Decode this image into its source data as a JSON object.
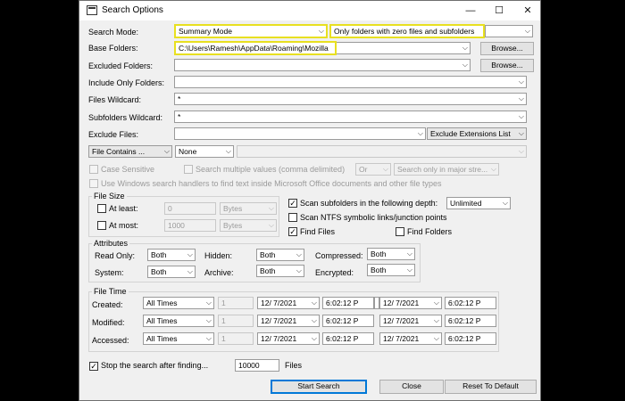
{
  "window": {
    "title": "Search Options",
    "minimize_glyph": "—",
    "maximize_glyph": "☐",
    "close_glyph": "✕"
  },
  "rows": {
    "search_mode_label": "Search Mode:",
    "search_mode_value": "Summary Mode",
    "summary_filter_value": "Only folders with zero files and subfolders",
    "base_folders_label": "Base Folders:",
    "base_folders_value": "C:\\Users\\Ramesh\\AppData\\Roaming\\Mozilla",
    "excluded_folders_label": "Excluded Folders:",
    "excluded_folders_value": "",
    "browse_label": "Browse...",
    "include_only_label": "Include Only Folders:",
    "files_wildcard_label": "Files Wildcard:",
    "files_wildcard_value": "*",
    "subfolders_wildcard_label": "Subfolders Wildcard:",
    "subfolders_wildcard_value": "*",
    "exclude_files_label": "Exclude Files:",
    "exclude_files_value": "",
    "exclude_ext_list": "Exclude Extensions List"
  },
  "contains": {
    "mode": "File Contains ...",
    "type": "None",
    "text": ""
  },
  "options": {
    "case_sensitive": "Case Sensitive",
    "multiple_values": "Search multiple values (comma delimited)",
    "or_value": "Or",
    "major_stream": "Search only in major stre...",
    "windows_handlers": "Use Windows search handlers to find text inside Microsoft Office documents and other file types"
  },
  "file_size": {
    "group_label": "File Size",
    "at_least_label": "At least:",
    "at_least_value": "0",
    "at_most_label": "At most:",
    "at_most_value": "1000",
    "unit": "Bytes"
  },
  "scan": {
    "subfolders_depth": "Scan subfolders in the following depth:",
    "depth_value": "Unlimited",
    "ntfs_links": "Scan NTFS symbolic links/junction points",
    "find_files": "Find Files",
    "find_folders": "Find Folders"
  },
  "attributes": {
    "group_label": "Attributes",
    "read_only_label": "Read Only:",
    "read_only_value": "Both",
    "hidden_label": "Hidden:",
    "hidden_value": "Both",
    "compressed_label": "Compressed:",
    "compressed_value": "Both",
    "system_label": "System:",
    "system_value": "Both",
    "archive_label": "Archive:",
    "archive_value": "Both",
    "encrypted_label": "Encrypted:",
    "encrypted_value": "Both"
  },
  "file_time": {
    "group_label": "File Time",
    "rows": [
      {
        "label": "Created:",
        "mode": "All Times",
        "num": "1",
        "date1": "12/ 7/2021",
        "time1": "6:02:12 P",
        "date2": "12/ 7/2021",
        "time2": "6:02:12 P"
      },
      {
        "label": "Modified:",
        "mode": "All Times",
        "num": "1",
        "date1": "12/ 7/2021",
        "time1": "6:02:12 P",
        "date2": "12/ 7/2021",
        "time2": "6:02:12 P"
      },
      {
        "label": "Accessed:",
        "mode": "All Times",
        "num": "1",
        "date1": "12/ 7/2021",
        "time1": "6:02:12 P",
        "date2": "12/ 7/2021",
        "time2": "6:02:12 P"
      }
    ]
  },
  "stop": {
    "label": "Stop the search after finding...",
    "value": "10000",
    "unit": "Files"
  },
  "buttons": {
    "start": "Start Search",
    "close": "Close",
    "reset": "Reset To Default"
  }
}
